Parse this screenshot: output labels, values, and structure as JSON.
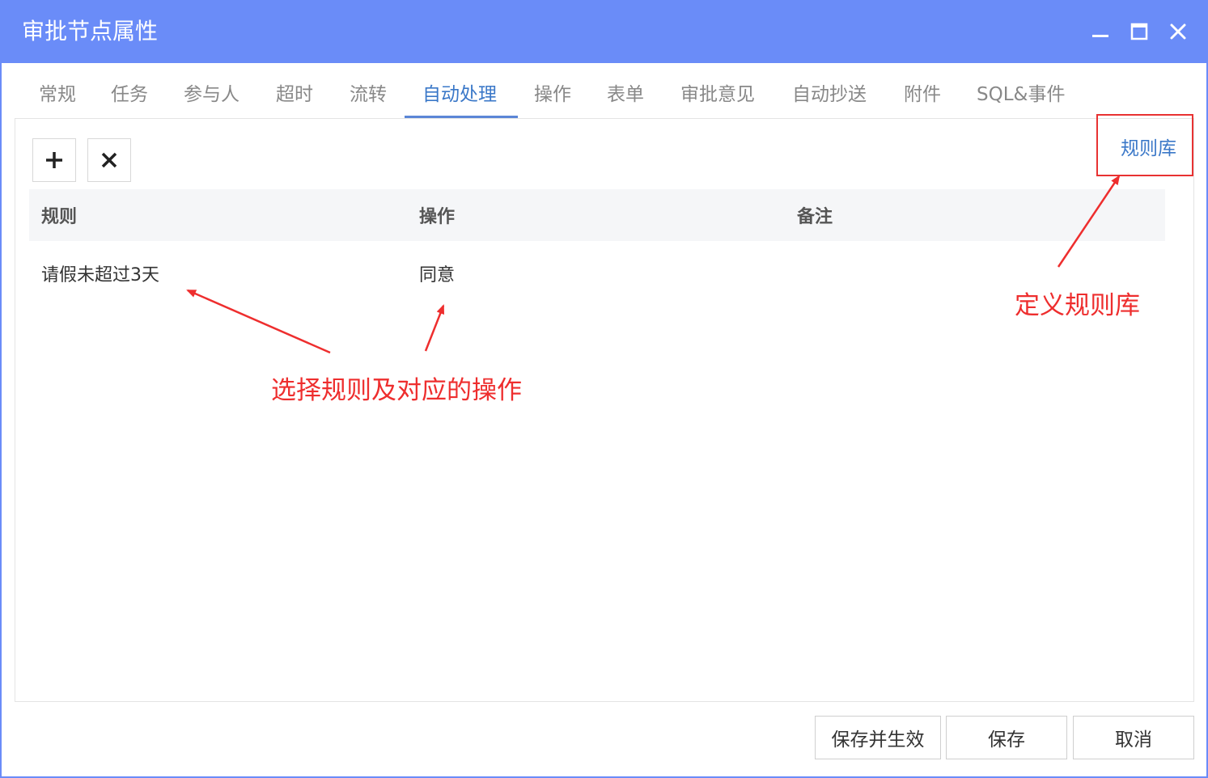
{
  "window": {
    "title": "审批节点属性",
    "accent_color": "#6a8cf8"
  },
  "tabs": [
    {
      "label": "常规"
    },
    {
      "label": "任务"
    },
    {
      "label": "参与人"
    },
    {
      "label": "超时"
    },
    {
      "label": "流转"
    },
    {
      "label": "自动处理",
      "active": true
    },
    {
      "label": "操作"
    },
    {
      "label": "表单"
    },
    {
      "label": "审批意见"
    },
    {
      "label": "自动抄送"
    },
    {
      "label": "附件"
    },
    {
      "label": "SQL&事件"
    }
  ],
  "toolbar": {
    "add_icon": "plus-icon",
    "delete_icon": "close-icon",
    "rule_library_label": "规则库"
  },
  "table": {
    "columns": [
      "规则",
      "操作",
      "备注"
    ],
    "rows": [
      {
        "rule": "请假未超过3天",
        "action": "同意",
        "note": ""
      }
    ]
  },
  "annotations": {
    "select_rule": "选择规则及对应的操作",
    "define_library": "定义规则库",
    "color": "#ee2e2e"
  },
  "footer": {
    "save_apply_label": "保存并生效",
    "save_label": "保存",
    "cancel_label": "取消"
  }
}
